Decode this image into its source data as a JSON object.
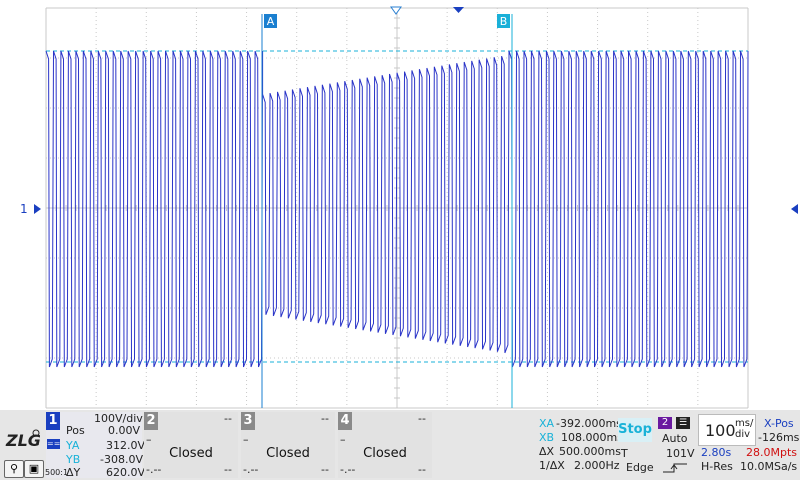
{
  "cursors": {
    "a_label": "A",
    "b_label": "B"
  },
  "channel_marker": "1",
  "ch1": {
    "number": "1",
    "scale": "100V/div",
    "pos_label": "Pos",
    "pos_value": "0.00V",
    "ya_label": "YA",
    "ya_value": "312.0V",
    "yb_label": "YB",
    "yb_value": "-308.0V",
    "dy_label": "ΔY",
    "dy_value": "620.0V",
    "probe": "500:1"
  },
  "channels": [
    {
      "number": "2",
      "status": "Closed",
      "top_dash": "--",
      "bottom_dash": "--",
      "bottom_left": "-.--"
    },
    {
      "number": "3",
      "status": "Closed",
      "top_dash": "--",
      "bottom_dash": "--",
      "bottom_left": "-.--"
    },
    {
      "number": "4",
      "status": "Closed",
      "top_dash": "--",
      "bottom_dash": "--",
      "bottom_left": "-.--"
    }
  ],
  "cursor_readout": {
    "xa_label": "XA",
    "xa_value": "-392.000ms",
    "xb_label": "XB",
    "xb_value": "108.000ms",
    "dx_label": "ΔX",
    "dx_value": "500.000ms",
    "inv_label": "1/ΔX",
    "inv_value": "2.000Hz"
  },
  "run_state": "Stop",
  "trigger": {
    "source": "2",
    "mode": "Auto",
    "t_label": "T",
    "level": "101V",
    "type": "Edge"
  },
  "timebase": {
    "value": "100",
    "unit_top": "ms/",
    "unit_bottom": "div",
    "xpos_label": "X-Pos",
    "xpos_value": "-126ms",
    "record_time": "2.80s",
    "points": "28.0Mpts",
    "acq_mode": "H-Res",
    "sample_rate": "10.0MSa/s"
  },
  "colors": {
    "trace": "#2a34c8",
    "cursor": "#1ab0d8",
    "grid": "#c9c9c9",
    "panel": "#e6e6e6",
    "ch1": "#1a3fc0",
    "red": "#d01010"
  },
  "icons": [
    "zlg-logo-icon",
    "zoom-icon",
    "screen-icon",
    "trigger-edge-icon",
    "menu-icon"
  ]
}
